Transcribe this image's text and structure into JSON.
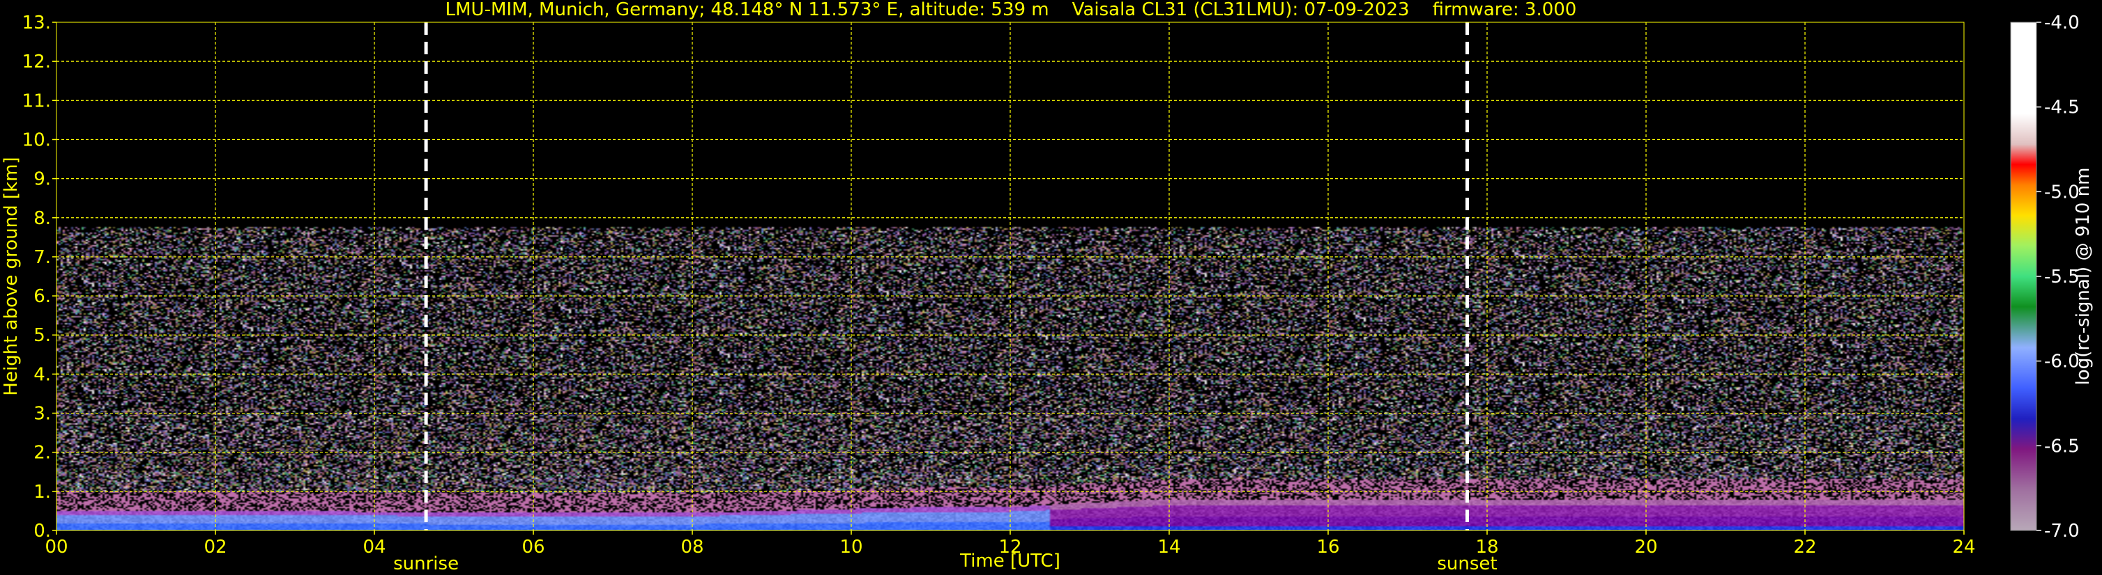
{
  "chart_data": {
    "type": "heatmap",
    "title": "LMU-MIM, Munich, Germany; 48.148° N 11.573° E, altitude: 539 m    Vaisala CL31 (CL31LMU): 07-09-2023    firmware: 3.000",
    "xlabel": "Time [UTC]",
    "ylabel": "Height above ground [km]",
    "xlim": [
      0,
      24
    ],
    "ylim": [
      0,
      13
    ],
    "x_ticks": [
      "00",
      "02",
      "04",
      "06",
      "08",
      "10",
      "12",
      "14",
      "16",
      "18",
      "20",
      "22",
      "24"
    ],
    "y_ticks": [
      "0.",
      "1.",
      "2.",
      "3.",
      "4.",
      "5.",
      "6.",
      "7.",
      "8.",
      "9.",
      "10.",
      "11.",
      "12.",
      "13."
    ],
    "grid": true,
    "annotations": [
      {
        "label": "sunrise",
        "x": 4.65
      },
      {
        "label": "sunset",
        "x": 17.75
      }
    ],
    "colorbar": {
      "label": "log(rc-signal) @ 910 nm",
      "range": [
        -7.0,
        -4.0
      ],
      "ticks": [
        "-4.0",
        "-4.5",
        "-5.0",
        "-5.5",
        "-6.0",
        "-6.5",
        "-7.0"
      ]
    },
    "signal_region_top_km": 7.75,
    "boundary_layer_top_km": [
      {
        "x": 0,
        "y": 0.5
      },
      {
        "x": 3,
        "y": 0.5
      },
      {
        "x": 5,
        "y": 0.45
      },
      {
        "x": 8,
        "y": 0.45
      },
      {
        "x": 10,
        "y": 0.55
      },
      {
        "x": 11,
        "y": 0.6
      },
      {
        "x": 12,
        "y": 0.6
      },
      {
        "x": 14,
        "y": 0.8
      },
      {
        "x": 24,
        "y": 0.8
      }
    ]
  },
  "colors": {
    "background": "#000000",
    "text": "#ffff00",
    "grid": "#ffff00",
    "marker_line": "#ffffff"
  }
}
